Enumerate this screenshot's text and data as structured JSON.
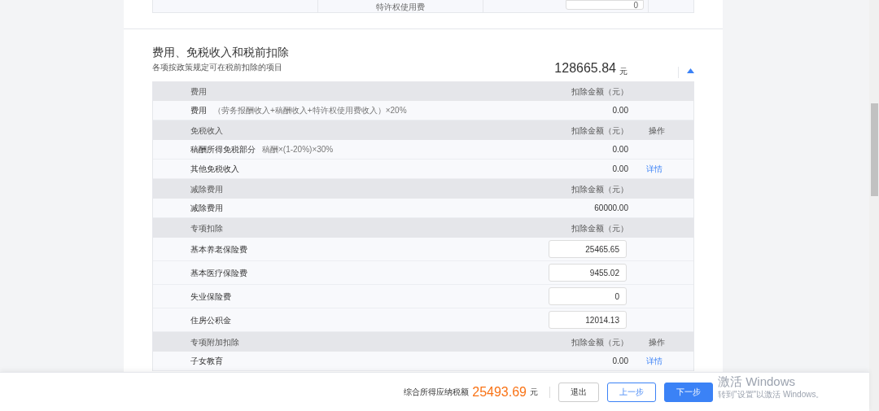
{
  "previous_row": {
    "label": "特许权使用费",
    "value": "0"
  },
  "section": {
    "title": "费用、免税收入和税前扣除",
    "subtitle": "各项按政策规定可在税前扣除的项目",
    "total": "128665.84",
    "unit": "元",
    "expanded": true
  },
  "groups": [
    {
      "label": "费用",
      "amount_header": "扣除金额（元）",
      "rows": [
        {
          "kind": "text",
          "label": "费用",
          "note": "（劳务报酬收入+稿酬收入+特许权使用费收入）×20%",
          "value": "0.00"
        }
      ]
    },
    {
      "label": "免税收入",
      "amount_header": "扣除金额（元）",
      "action_header": "操作",
      "rows": [
        {
          "kind": "text",
          "label": "稿酬所得免税部分",
          "note": "稿酬×(1-20%)×30%",
          "value": "0.00"
        },
        {
          "kind": "text",
          "label": "其他免税收入",
          "value": "0.00",
          "link": "详情"
        }
      ]
    },
    {
      "label": "减除费用",
      "amount_header": "扣除金额（元）",
      "rows": [
        {
          "kind": "text",
          "label": "减除费用",
          "value": "60000.00"
        }
      ]
    },
    {
      "label": "专项扣除",
      "amount_header": "扣除金额（元）",
      "rows": [
        {
          "kind": "input",
          "label": "基本养老保险费",
          "value": "25465.65"
        },
        {
          "kind": "input",
          "label": "基本医疗保险费",
          "value": "9455.02"
        },
        {
          "kind": "input",
          "label": "失业保险费",
          "value": "0"
        },
        {
          "kind": "input",
          "label": "住房公积金",
          "value": "12014.13"
        }
      ]
    },
    {
      "label": "专项附加扣除",
      "amount_header": "扣除金额（元）",
      "action_header": "操作",
      "rows": [
        {
          "kind": "text",
          "label": "子女教育",
          "value": "0.00",
          "link": "详情"
        }
      ]
    }
  ],
  "footer": {
    "label": "综合所得应纳税额",
    "amount": "25493.69",
    "unit": "元",
    "buttons": [
      {
        "label": "退出",
        "kind": "plain"
      },
      {
        "label": "上一步",
        "kind": "outline"
      },
      {
        "label": "下一步",
        "kind": "primary"
      }
    ]
  },
  "os_notice": {
    "title": "激活 Windows",
    "text": "转到\"设置\"以激活 Windows。"
  }
}
